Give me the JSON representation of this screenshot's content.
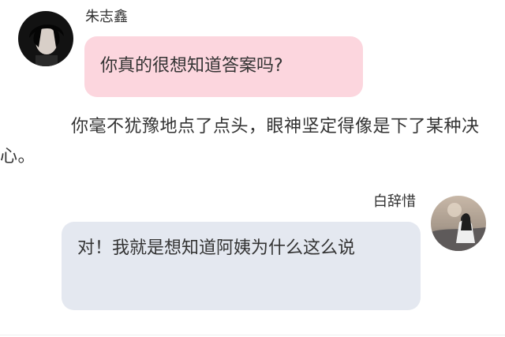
{
  "messages": {
    "first": {
      "sender": "朱志鑫",
      "text": "你真的很想知道答案吗?"
    },
    "narration": "你毫不犹豫地点了点头，眼神坚定得像是下了某种决心。",
    "second": {
      "sender": "白辞惜",
      "text": "对！我就是想知道阿姨为什么这么说"
    }
  },
  "colors": {
    "left_bubble": "#fcd6de",
    "right_bubble": "#e4e8f0"
  },
  "icons": {
    "left_avatar": "avatar-photo-icon",
    "right_avatar": "avatar-photo-icon"
  }
}
